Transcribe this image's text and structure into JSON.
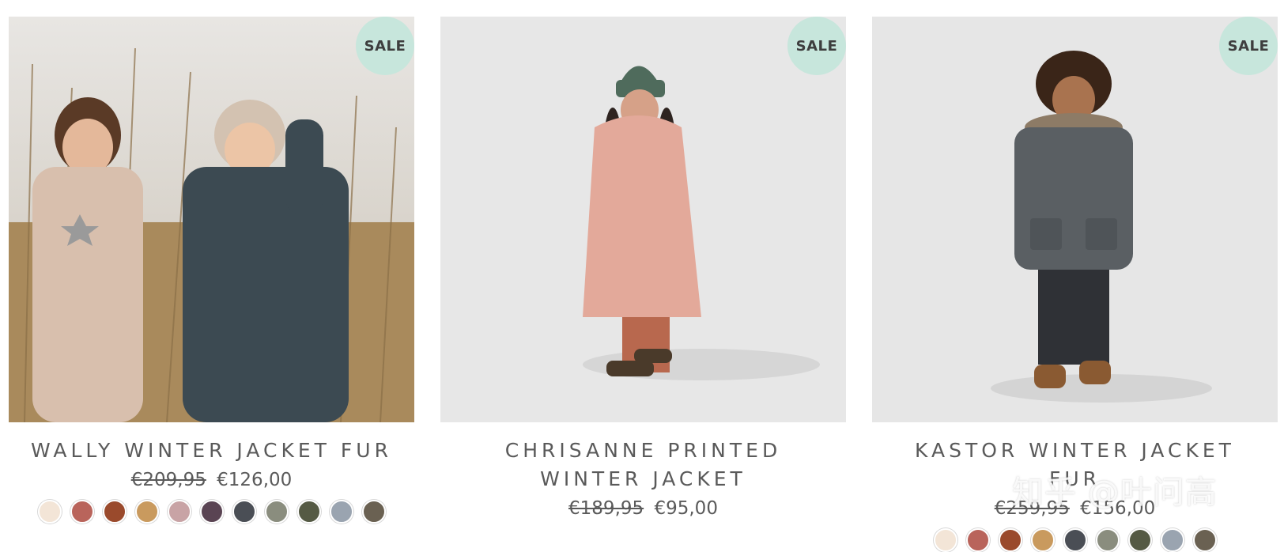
{
  "products": [
    {
      "title": "WALLY WINTER JACKET FUR",
      "badge": "SALE",
      "old_price": "€209,95",
      "new_price": "€126,00",
      "image_icon": "children-in-snowsuits-photo",
      "swatches": [
        "#f3e5d7",
        "#b9645b",
        "#9a4a2c",
        "#c99a5e",
        "#c8a3a5",
        "#5a4453",
        "#4a4e55",
        "#8a8d7e",
        "#555a44",
        "#9aa4b0",
        "#6a6152"
      ]
    },
    {
      "title": "CHRISANNE PRINTED WINTER JACKET",
      "badge": "SALE",
      "old_price": "€189,95",
      "new_price": "€95,00",
      "image_icon": "girl-in-pink-coat-photo",
      "swatches": []
    },
    {
      "title": "KASTOR WINTER JACKET FUR",
      "badge": "SALE",
      "old_price": "€259,95",
      "new_price": "€156,00",
      "image_icon": "boy-in-grey-parka-photo",
      "swatches": [
        "#f3e5d7",
        "#b9645b",
        "#9a4a2c",
        "#c99a5e",
        "#4a4e55",
        "#8a8d7e",
        "#555a44",
        "#9aa4b0",
        "#6a6152"
      ]
    }
  ],
  "watermark": "知乎 @叶问高"
}
